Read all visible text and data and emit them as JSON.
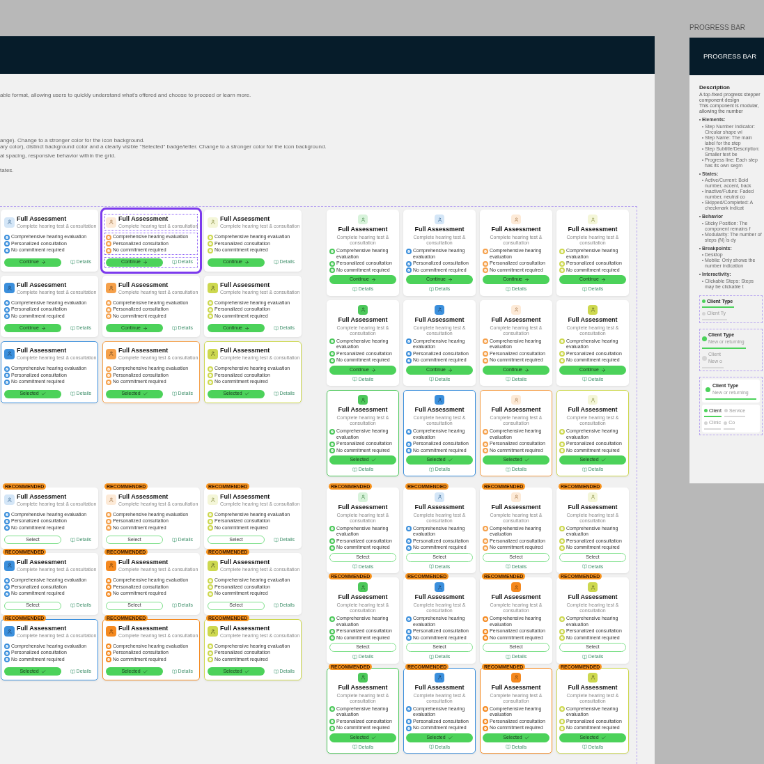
{
  "main_artboard": {
    "description_lines": [
      "able format, allowing users to quickly understand what's offered and choose to proceed or learn more.",
      "ange).  Change to a stronger color for the icon background.",
      "ary color), distinct background color and a clearly visible \"Selected\" badge/letter.  Change to a stronger color for the icon background.",
      "al spacing, responsive behavior within the grid.",
      "tates."
    ],
    "card_groups": [
      {
        "kind": "horizontal",
        "cards": [
          {
            "kind": "light",
            "color": "#3b8fdc",
            "selected": false,
            "highlighted": false,
            "title": "Full Assessment",
            "subtitle": "Complete hearing test & consultation",
            "features": [
              "Comprehensive hearing evaluation",
              "Personalized consultation",
              "No commitment required"
            ],
            "button": {
              "kind": "continue",
              "label": "Continue"
            },
            "details": "Details"
          },
          {
            "kind": "light",
            "color": "#f5a04a",
            "selected": false,
            "highlighted": true,
            "title": "Full Assessment",
            "subtitle": "Complete hearing test & consultation",
            "features": [
              "Comprehensive hearing evaluation",
              "Personalized consultation",
              "No commitment required"
            ],
            "button": {
              "kind": "continue",
              "label": "Continue"
            },
            "details": "Details"
          },
          {
            "kind": "light",
            "color": "#cdd84f",
            "selected": false,
            "highlighted": false,
            "title": "Full Assessment",
            "subtitle": "Complete hearing test & consultation",
            "features": [
              "Comprehensive hearing evaluation",
              "Personalized consultation",
              "No commitment required"
            ],
            "button": {
              "kind": "continue",
              "label": "Continue"
            },
            "details": "Details"
          },
          {
            "kind": "strong",
            "color": "#3b8fdc",
            "selected": false,
            "highlighted": false,
            "title": "Full Assessment",
            "subtitle": "Complete hearing test & consultation",
            "features": [
              "Comprehensive hearing evaluation",
              "Personalized consultation",
              "No commitment required"
            ],
            "button": {
              "kind": "continue",
              "label": "Continue"
            },
            "details": "Details"
          },
          {
            "kind": "strong",
            "color": "#f5a04a",
            "selected": false,
            "highlighted": false,
            "title": "Full Assessment",
            "subtitle": "Complete hearing test & consultation",
            "features": [
              "Comprehensive hearing evaluation",
              "Personalized consultation",
              "No commitment required"
            ],
            "button": {
              "kind": "continue",
              "label": "Continue"
            },
            "details": "Details"
          },
          {
            "kind": "strong",
            "color": "#cdd84f",
            "selected": false,
            "highlighted": false,
            "title": "Full Assessment",
            "subtitle": "Complete hearing test & consultation",
            "features": [
              "Comprehensive hearing evaluation",
              "Personalized consultation",
              "No commitment required"
            ],
            "button": {
              "kind": "continue",
              "label": "Continue"
            },
            "details": "Details"
          },
          {
            "kind": "strong",
            "color": "#3b8fdc",
            "selected": true,
            "highlighted": false,
            "title": "Full Assessment",
            "subtitle": "Complete hearing test & consultation",
            "features": [
              "Comprehensive hearing evaluation",
              "Personalized consultation",
              "No commitment required"
            ],
            "button": {
              "kind": "selected",
              "label": "Selected"
            },
            "details": "Details"
          },
          {
            "kind": "strong",
            "color": "#f5a04a",
            "selected": true,
            "highlighted": false,
            "title": "Full Assessment",
            "subtitle": "Complete hearing test & consultation",
            "features": [
              "Comprehensive hearing evaluation",
              "Personalized consultation",
              "No commitment required"
            ],
            "button": {
              "kind": "selected",
              "label": "Selected"
            },
            "details": "Details"
          },
          {
            "kind": "strong",
            "color": "#cdd84f",
            "selected": true,
            "highlighted": false,
            "title": "Full Assessment",
            "subtitle": "Complete hearing test & consultation",
            "features": [
              "Comprehensive hearing evaluation",
              "Personalized consultation",
              "No commitment required"
            ],
            "button": {
              "kind": "selected",
              "label": "Selected"
            },
            "details": "Details"
          }
        ]
      },
      {
        "kind": "vertical",
        "cards": [
          {
            "kind": "light",
            "color": "#4cc85a",
            "selected": false,
            "highlighted": false,
            "title": "Full Assessment",
            "subtitle": "Complete hearing test & consultation",
            "features": [
              "Comprehensive hearing evaluation",
              "Personalized consultation",
              "No commitment required"
            ],
            "button": {
              "kind": "continue",
              "label": "Continue"
            },
            "details": "Details"
          },
          {
            "kind": "light",
            "color": "#3b8fdc",
            "selected": false,
            "highlighted": false,
            "title": "Full Assessment",
            "subtitle": "Complete hearing test & consultation",
            "features": [
              "Comprehensive hearing evaluation",
              "Personalized consultation",
              "No commitment required"
            ],
            "button": {
              "kind": "continue",
              "label": "Continue"
            },
            "details": "Details"
          },
          {
            "kind": "light",
            "color": "#f5a04a",
            "selected": false,
            "highlighted": false,
            "title": "Full Assessment",
            "subtitle": "Complete hearing test & consultation",
            "features": [
              "Comprehensive hearing evaluation",
              "Personalized consultation",
              "No commitment required"
            ],
            "button": {
              "kind": "continue",
              "label": "Continue"
            },
            "details": "Details"
          },
          {
            "kind": "light",
            "color": "#cdd84f",
            "selected": false,
            "highlighted": false,
            "title": "Full Assessment",
            "subtitle": "Complete hearing test & consultation",
            "features": [
              "Comprehensive hearing evaluation",
              "Personalized consultation",
              "No commitment required"
            ],
            "button": {
              "kind": "continue",
              "label": "Continue"
            },
            "details": "Details"
          },
          {
            "kind": "strong",
            "color": "#4cc85a",
            "selected": false,
            "highlighted": false,
            "title": "Full Assessment",
            "subtitle": "Complete hearing test & consultation",
            "features": [
              "Comprehensive hearing evaluation",
              "Personalized consultation",
              "No commitment required"
            ],
            "button": {
              "kind": "continue",
              "label": "Continue"
            },
            "details": "Details"
          },
          {
            "kind": "strong",
            "color": "#3b8fdc",
            "selected": false,
            "highlighted": false,
            "title": "Full Assessment",
            "subtitle": "Complete hearing test & consultation",
            "features": [
              "Comprehensive hearing evaluation",
              "Personalized consultation",
              "No commitment required"
            ],
            "button": {
              "kind": "continue",
              "label": "Continue"
            },
            "details": "Details"
          },
          {
            "kind": "light",
            "color": "#f5a04a",
            "selected": false,
            "highlighted": false,
            "title": "Full Assessment",
            "subtitle": "Complete hearing test & consultation",
            "features": [
              "Comprehensive hearing evaluation",
              "Personalized consultation",
              "No commitment required"
            ],
            "button": {
              "kind": "continue",
              "label": "Continue"
            },
            "details": "Details"
          },
          {
            "kind": "strong",
            "color": "#cdd84f",
            "selected": false,
            "highlighted": false,
            "title": "Full Assessment",
            "subtitle": "Complete hearing test & consultation",
            "features": [
              "Comprehensive hearing evaluation",
              "Personalized consultation",
              "No commitment required"
            ],
            "button": {
              "kind": "continue",
              "label": "Continue"
            },
            "details": "Details"
          },
          {
            "kind": "strong",
            "color": "#4cc85a",
            "selected": true,
            "highlighted": false,
            "title": "Full Assessment",
            "subtitle": "Complete hearing test & consultation",
            "features": [
              "Comprehensive hearing evaluation",
              "Personalized consultation",
              "No commitment required"
            ],
            "button": {
              "kind": "selected",
              "label": "Selected"
            },
            "details": "Details"
          },
          {
            "kind": "strong",
            "color": "#3b8fdc",
            "selected": true,
            "highlighted": false,
            "title": "Full Assessment",
            "subtitle": "Complete hearing test & consultation",
            "features": [
              "Comprehensive hearing evaluation",
              "Personalized consultation",
              "No commitment required"
            ],
            "button": {
              "kind": "selected",
              "label": "Selected"
            },
            "details": "Details"
          },
          {
            "kind": "light",
            "color": "#f5a04a",
            "selected": true,
            "highlighted": false,
            "title": "Full Assessment",
            "subtitle": "Complete hearing test & consultation",
            "features": [
              "Comprehensive hearing evaluation",
              "Personalized consultation",
              "No commitment required"
            ],
            "button": {
              "kind": "selected",
              "label": "Selected"
            },
            "details": "Details"
          },
          {
            "kind": "light",
            "color": "#cdd84f",
            "selected": true,
            "highlighted": false,
            "title": "Full Assessment",
            "subtitle": "Complete hearing test & consultation",
            "features": [
              "Comprehensive hearing evaluation",
              "Personalized consultation",
              "No commitment required"
            ],
            "button": {
              "kind": "selected",
              "label": "Selected"
            },
            "details": "Details"
          }
        ]
      },
      {
        "kind": "horizontal",
        "cards": [
          {
            "badge": "RECOMMENDED",
            "kind": "light",
            "color": "#3b8fdc",
            "selected": false,
            "highlighted": false,
            "title": "Full Assessment",
            "subtitle": "Complete hearing test & consultation",
            "features": [
              "Comprehensive hearing evaluation",
              "Personalized consultation",
              "No commitment required"
            ],
            "button": {
              "kind": "select",
              "label": "Select"
            },
            "details": "Details"
          },
          {
            "badge": "RECOMMENDED",
            "kind": "light",
            "color": "#f5a04a",
            "selected": false,
            "highlighted": false,
            "title": "Full Assessment",
            "subtitle": "Complete hearing test & consultation",
            "features": [
              "Comprehensive hearing evaluation",
              "Personalized consultation",
              "No commitment required"
            ],
            "button": {
              "kind": "select",
              "label": "Select"
            },
            "details": "Details"
          },
          {
            "badge": "RECOMMENDED",
            "kind": "light",
            "color": "#cdd84f",
            "selected": false,
            "highlighted": false,
            "title": "Full Assessment",
            "subtitle": "Complete hearing test & consultation",
            "features": [
              "Comprehensive hearing evaluation",
              "Personalized consultation",
              "No commitment required"
            ],
            "button": {
              "kind": "select",
              "label": "Select"
            },
            "details": "Details"
          },
          {
            "badge": "RECOMMENDED",
            "kind": "strong",
            "color": "#3b8fdc",
            "selected": false,
            "highlighted": false,
            "title": "Full Assessment",
            "subtitle": "Complete hearing test & consultation",
            "features": [
              "Comprehensive hearing evaluation",
              "Personalized consultation",
              "No commitment required"
            ],
            "button": {
              "kind": "select",
              "label": "Select"
            },
            "details": "Details"
          },
          {
            "badge": "RECOMMENDED",
            "kind": "strong",
            "color": "#f5891f",
            "selected": false,
            "highlighted": false,
            "title": "Full Assessment",
            "subtitle": "Complete hearing test & consultation",
            "features": [
              "Comprehensive hearing evaluation",
              "Personalized consultation",
              "No commitment required"
            ],
            "button": {
              "kind": "select",
              "label": "Select"
            },
            "details": "Details"
          },
          {
            "badge": "RECOMMENDED",
            "kind": "strong",
            "color": "#cdd84f",
            "selected": false,
            "highlighted": false,
            "title": "Full Assessment",
            "subtitle": "Complete hearing test & consultation",
            "features": [
              "Comprehensive hearing evaluation",
              "Personalized consultation",
              "No commitment required"
            ],
            "button": {
              "kind": "select",
              "label": "Select"
            },
            "details": "Details"
          },
          {
            "badge": "RECOMMENDED",
            "kind": "strong",
            "color": "#3b8fdc",
            "selected": true,
            "highlighted": false,
            "title": "Full Assessment",
            "subtitle": "Complete hearing test & consultation",
            "features": [
              "Comprehensive hearing evaluation",
              "Personalized consultation",
              "No commitment required"
            ],
            "button": {
              "kind": "selected",
              "label": "Selected"
            },
            "details": "Details"
          },
          {
            "badge": "RECOMMENDED",
            "kind": "strong",
            "color": "#f5891f",
            "selected": true,
            "highlighted": false,
            "title": "Full Assessment",
            "subtitle": "Complete hearing test & consultation",
            "features": [
              "Comprehensive hearing evaluation",
              "Personalized consultation",
              "No commitment required"
            ],
            "button": {
              "kind": "selected",
              "label": "Selected"
            },
            "details": "Details"
          },
          {
            "badge": "RECOMMENDED",
            "kind": "strong",
            "color": "#cdd84f",
            "selected": true,
            "highlighted": false,
            "title": "Full Assessment",
            "subtitle": "Complete hearing test & consultation",
            "features": [
              "Comprehensive hearing evaluation",
              "Personalized consultation",
              "No commitment required"
            ],
            "button": {
              "kind": "selected",
              "label": "Selected"
            },
            "details": "Details"
          }
        ]
      },
      {
        "kind": "vertical",
        "cards": [
          {
            "badge": "RECOMMENDED",
            "kind": "light",
            "color": "#4cc85a",
            "selected": false,
            "highlighted": false,
            "title": "Full Assessment",
            "subtitle": "Complete hearing test & consultation",
            "features": [
              "Comprehensive hearing evaluation",
              "Personalized consultation",
              "No commitment required"
            ],
            "button": {
              "kind": "select",
              "label": "Select"
            },
            "details": "Details"
          },
          {
            "badge": "RECOMMENDED",
            "kind": "light",
            "color": "#3b8fdc",
            "selected": false,
            "highlighted": false,
            "title": "Full Assessment",
            "subtitle": "Complete hearing test & consultation",
            "features": [
              "Comprehensive hearing evaluation",
              "Personalized consultation",
              "No commitment required"
            ],
            "button": {
              "kind": "select",
              "label": "Select"
            },
            "details": "Details"
          },
          {
            "badge": "RECOMMENDED",
            "kind": "light",
            "color": "#f5a04a",
            "selected": false,
            "highlighted": false,
            "title": "Full Assessment",
            "subtitle": "Complete hearing test & consultation",
            "features": [
              "Comprehensive hearing evaluation",
              "Personalized consultation",
              "No commitment required"
            ],
            "button": {
              "kind": "select",
              "label": "Select"
            },
            "details": "Details"
          },
          {
            "badge": "RECOMMENDED",
            "kind": "light",
            "color": "#cdd84f",
            "selected": false,
            "highlighted": false,
            "title": "Full Assessment",
            "subtitle": "Complete hearing test & consultation",
            "features": [
              "Comprehensive hearing evaluation",
              "Personalized consultation",
              "No commitment required"
            ],
            "button": {
              "kind": "select",
              "label": "Select"
            },
            "details": "Details"
          },
          {
            "badge": "RECOMMENDED",
            "kind": "strong",
            "color": "#4cc85a",
            "selected": false,
            "highlighted": false,
            "title": "Full Assessment",
            "subtitle": "Complete hearing test & consultation",
            "features": [
              "Comprehensive hearing evaluation",
              "Personalized consultation",
              "No commitment required"
            ],
            "button": {
              "kind": "select",
              "label": "Select"
            },
            "details": "Details"
          },
          {
            "badge": "RECOMMENDED",
            "kind": "strong",
            "color": "#3b8fdc",
            "selected": false,
            "highlighted": false,
            "title": "Full Assessment",
            "subtitle": "Complete hearing test & consultation",
            "features": [
              "Comprehensive hearing evaluation",
              "Personalized consultation",
              "No commitment required"
            ],
            "button": {
              "kind": "select",
              "label": "Select"
            },
            "details": "Details"
          },
          {
            "badge": "RECOMMENDED",
            "kind": "strong",
            "color": "#f5891f",
            "selected": false,
            "highlighted": false,
            "title": "Full Assessment",
            "subtitle": "Complete hearing test & consultation",
            "features": [
              "Comprehensive hearing evaluation",
              "Personalized consultation",
              "No commitment required"
            ],
            "button": {
              "kind": "select",
              "label": "Select"
            },
            "details": "Details"
          },
          {
            "badge": "RECOMMENDED",
            "kind": "strong",
            "color": "#cdd84f",
            "selected": false,
            "highlighted": false,
            "title": "Full Assessment",
            "subtitle": "Complete hearing test & consultation",
            "features": [
              "Comprehensive hearing evaluation",
              "Personalized consultation",
              "No commitment required"
            ],
            "button": {
              "kind": "select",
              "label": "Select"
            },
            "details": "Details"
          },
          {
            "badge": "RECOMMENDED",
            "kind": "strong",
            "color": "#4cc85a",
            "selected": true,
            "highlighted": false,
            "title": "Full Assessment",
            "subtitle": "Complete hearing test & consultation",
            "features": [
              "Comprehensive hearing evaluation",
              "Personalized consultation",
              "No commitment required"
            ],
            "button": {
              "kind": "selected",
              "label": "Selected"
            },
            "details": "Details"
          },
          {
            "badge": "RECOMMENDED",
            "kind": "strong",
            "color": "#3b8fdc",
            "selected": true,
            "highlighted": false,
            "title": "Full Assessment",
            "subtitle": "Complete hearing test & consultation",
            "features": [
              "Comprehensive hearing evaluation",
              "Personalized consultation",
              "No commitment required"
            ],
            "button": {
              "kind": "selected",
              "label": "Selected"
            },
            "details": "Details"
          },
          {
            "badge": "RECOMMENDED",
            "kind": "strong",
            "color": "#f5891f",
            "selected": true,
            "highlighted": false,
            "title": "Full Assessment",
            "subtitle": "Complete hearing test & consultation",
            "features": [
              "Comprehensive hearing evaluation",
              "Personalized consultation",
              "No commitment required"
            ],
            "button": {
              "kind": "selected",
              "label": "Selected"
            },
            "details": "Details"
          },
          {
            "badge": "RECOMMENDED",
            "kind": "strong",
            "color": "#cdd84f",
            "selected": true,
            "highlighted": false,
            "title": "Full Assessment",
            "subtitle": "Complete hearing test & consultation",
            "features": [
              "Comprehensive hearing evaluation",
              "Personalized consultation",
              "No commitment required"
            ],
            "button": {
              "kind": "selected",
              "label": "Selected"
            },
            "details": "Details"
          }
        ]
      }
    ]
  },
  "progress_artboard": {
    "label": "PROGRESS BAR",
    "header": "PROGRESS BAR",
    "description_title": "Description",
    "intro": [
      "A top-fixed progress stepper component design",
      "This component is modular, allowing the number"
    ],
    "sections": [
      {
        "title": "Elements:",
        "items": [
          "Step Number Indicator: Circular shape wi",
          "Step Name: The main label for the step",
          "Step Subtitle/Description: Smaller text be",
          "Progress line: Each step has its own segm"
        ]
      },
      {
        "title": "States:",
        "items": [
          "Active/Current: Bold number, accent, back",
          "Inactive/Future: Faded number, neutral co",
          "Skipped/Completed: A checkmark indicat"
        ]
      },
      {
        "title": "Behavior",
        "items": [
          "Sticky Position: The component remains f",
          "Modularity: The number of steps (N) is dy"
        ]
      },
      {
        "title": "Breakpoints:",
        "items": [
          "Desktop",
          "Mobile: Only shows the number indication"
        ]
      },
      {
        "title": "Interactivity:",
        "items": [
          "Clickable Steps: Steps may be clickable t"
        ]
      }
    ],
    "steppers": [
      {
        "kind": "compact",
        "steps": [
          {
            "name": "Client Type",
            "selected": true
          },
          {
            "name": "Client Ty",
            "selected": false
          }
        ]
      },
      {
        "kind": "subtitle",
        "steps": [
          {
            "name": "Client Type",
            "subtitle": "New or returning",
            "selected": true
          },
          {
            "name": "Client",
            "subtitle": "New o",
            "selected": false
          }
        ]
      },
      {
        "kind": "desktop",
        "steps": [
          {
            "name": "Client Type",
            "subtitle": "New or returning",
            "selected": true
          }
        ]
      },
      {
        "kind": "mobile",
        "steps": [
          {
            "name": "Client",
            "selected": true
          },
          {
            "name": "Service",
            "selected": false
          },
          {
            "name": "Clinic",
            "selected": false
          },
          {
            "name": "Co",
            "selected": false
          }
        ]
      }
    ]
  }
}
